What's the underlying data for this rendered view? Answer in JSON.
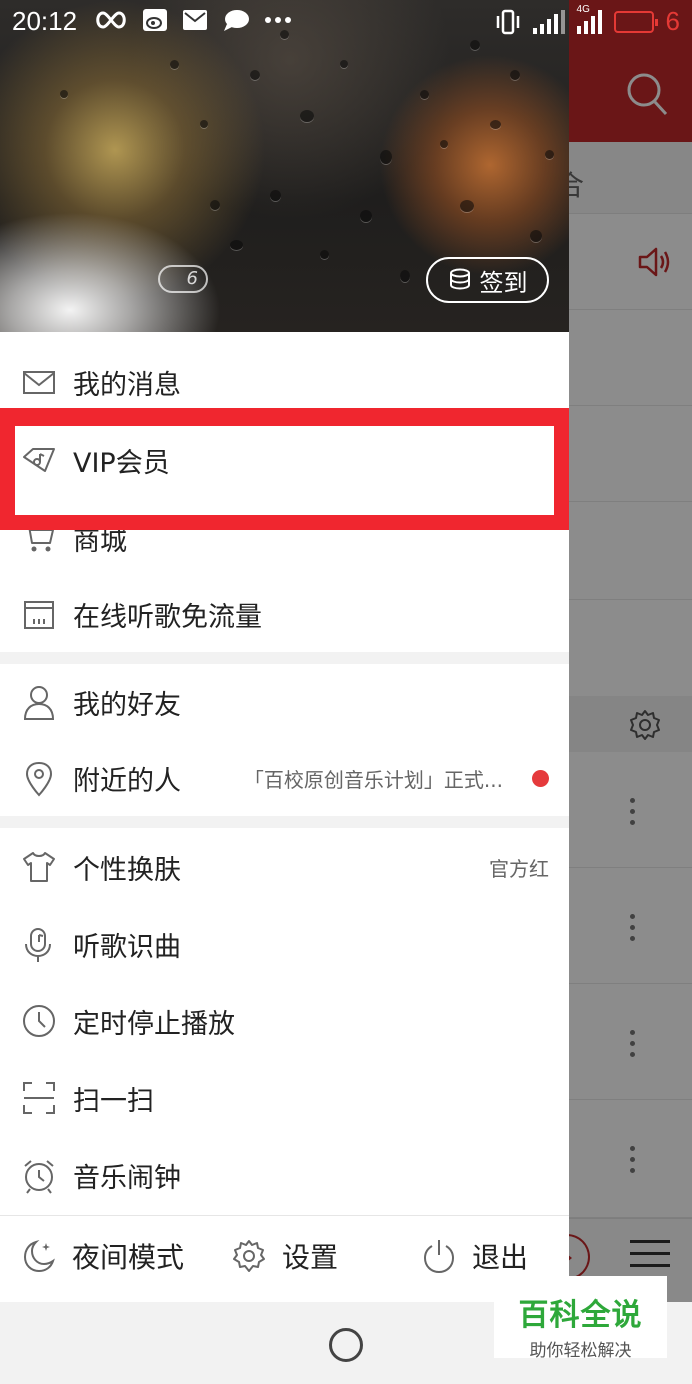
{
  "status_bar": {
    "time": "20:12",
    "battery_level": "6",
    "network": "4G"
  },
  "drawer": {
    "header": {
      "level": "6",
      "signin_label": "签到"
    },
    "menu_group1": [
      {
        "label": "我的消息",
        "icon": "mail-icon"
      },
      {
        "label": "VIP会员",
        "icon": "vip-diamond-icon"
      },
      {
        "label": "商城",
        "icon": "cart-icon"
      },
      {
        "label": "在线听歌免流量",
        "icon": "sim-card-icon"
      }
    ],
    "menu_group2": [
      {
        "label": "我的好友",
        "icon": "person-icon"
      },
      {
        "label": "附近的人",
        "icon": "location-icon",
        "right_text": "「百校原创音乐计划」正式..."
      }
    ],
    "menu_group3": [
      {
        "label": "个性换肤",
        "icon": "tshirt-icon",
        "right_text": "官方红"
      },
      {
        "label": "听歌识曲",
        "icon": "mic-note-icon"
      },
      {
        "label": "定时停止播放",
        "icon": "clock-icon"
      },
      {
        "label": "扫一扫",
        "icon": "scan-icon"
      },
      {
        "label": "音乐闹钟",
        "icon": "alarm-icon"
      }
    ],
    "bottom_bar": {
      "night_mode": "夜间模式",
      "settings": "设置",
      "logout": "退出"
    }
  },
  "background_app": {
    "tab_partial": "合"
  },
  "watermark": {
    "main": "百科全说",
    "sub": "助你轻松解决"
  },
  "colors": {
    "brand_red": "#c1282b",
    "highlight_red": "#f0262f",
    "badge_red": "#e53a3c",
    "watermark_green": "#2ea83a"
  }
}
